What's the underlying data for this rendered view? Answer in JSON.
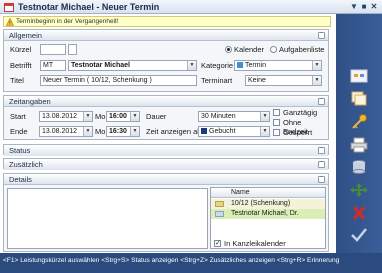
{
  "window": {
    "title": "Testnotar Michael - Neuer Termin"
  },
  "warning": {
    "text": "Terminbeginn in der Vergangenheit!"
  },
  "allgemein": {
    "header": "Allgemein",
    "kuerzel_label": "Kürzel",
    "kuerzel_value": "",
    "betrifft_label": "Betrifft",
    "betrifft_code": "MT",
    "betrifft_name": "Testnotar Michael",
    "titel_label": "Titel",
    "titel_value": "Neuer Termin ( 10/12, Schenkung )",
    "radio_kalender": "Kalender",
    "radio_aufgabenliste": "Aufgabenliste",
    "kategorie_label": "Kategorie",
    "kategorie_value": "Termin",
    "terminart_label": "Terminart",
    "terminart_value": "Keine"
  },
  "zeitangaben": {
    "header": "Zeitangaben",
    "start_label": "Start",
    "start_date": "13.08.2012",
    "start_day": "Mo",
    "start_time": "16:00",
    "ende_label": "Ende",
    "ende_date": "13.08.2012",
    "ende_day": "Mo",
    "ende_time": "16:30",
    "dauer_label": "Dauer",
    "dauer_value": "30 Minuten",
    "zeit_anzeigen_label": "Zeit anzeigen als",
    "zeit_anzeigen_value": "Gebucht",
    "ganztaegig": "Ganztägig",
    "ohne_endzeit": "Ohne Endzeit",
    "gesperrt": "Gesperrt"
  },
  "status_section": {
    "header": "Status"
  },
  "zusaetzlich": {
    "header": "Zusätzlich"
  },
  "details": {
    "header": "Details",
    "table_header": "Name",
    "rows": [
      "10/12 (Schenkung)",
      "Testnotar Michael, Dr."
    ],
    "kanzlei_label": "In Kanzleikalender"
  },
  "statusbar": {
    "text": "<F1> Leistungskürzel auswählen <Strg+S> Status anzeigen <Strg+Z> Zusätzliches anzeigen <Strg+R> Erinnerung"
  },
  "colors": {
    "sidebar": "#2f4f86",
    "warning_bg": "#ffffc8",
    "row_highlight": "#dbeeb8"
  }
}
